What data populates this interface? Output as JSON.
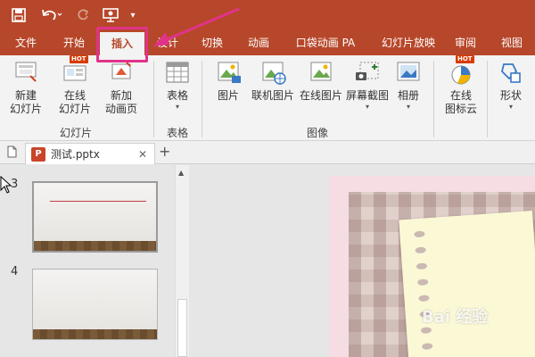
{
  "ribbon_tabs": [
    "文件",
    "开始",
    "插入",
    "设计",
    "切换",
    "动画",
    "口袋动画 PA",
    "幻灯片放映",
    "审阅",
    "视图"
  ],
  "slides_group": {
    "new_slide": "新建\n幻灯片",
    "online_slide": "在线\n幻灯片",
    "new_anim_page": "新加\n动画页",
    "label": "幻灯片"
  },
  "table_group": {
    "table": "表格",
    "label": "表格"
  },
  "images_group": {
    "picture": "图片",
    "online_picture": "联机图片",
    "online_pic2": "在线图片",
    "screenshot": "屏幕截图",
    "album": "相册",
    "label": "图像"
  },
  "online_icons": "在线\n图标云",
  "shapes": "形状",
  "hot_badge": "HOT",
  "document_tab": {
    "name": "测试.pptx"
  },
  "slides": [
    {
      "number": "3"
    },
    {
      "number": "4"
    }
  ],
  "watermark": "Bai 经验",
  "colors": {
    "accent": "#b7472a",
    "highlight": "#e0338a"
  }
}
